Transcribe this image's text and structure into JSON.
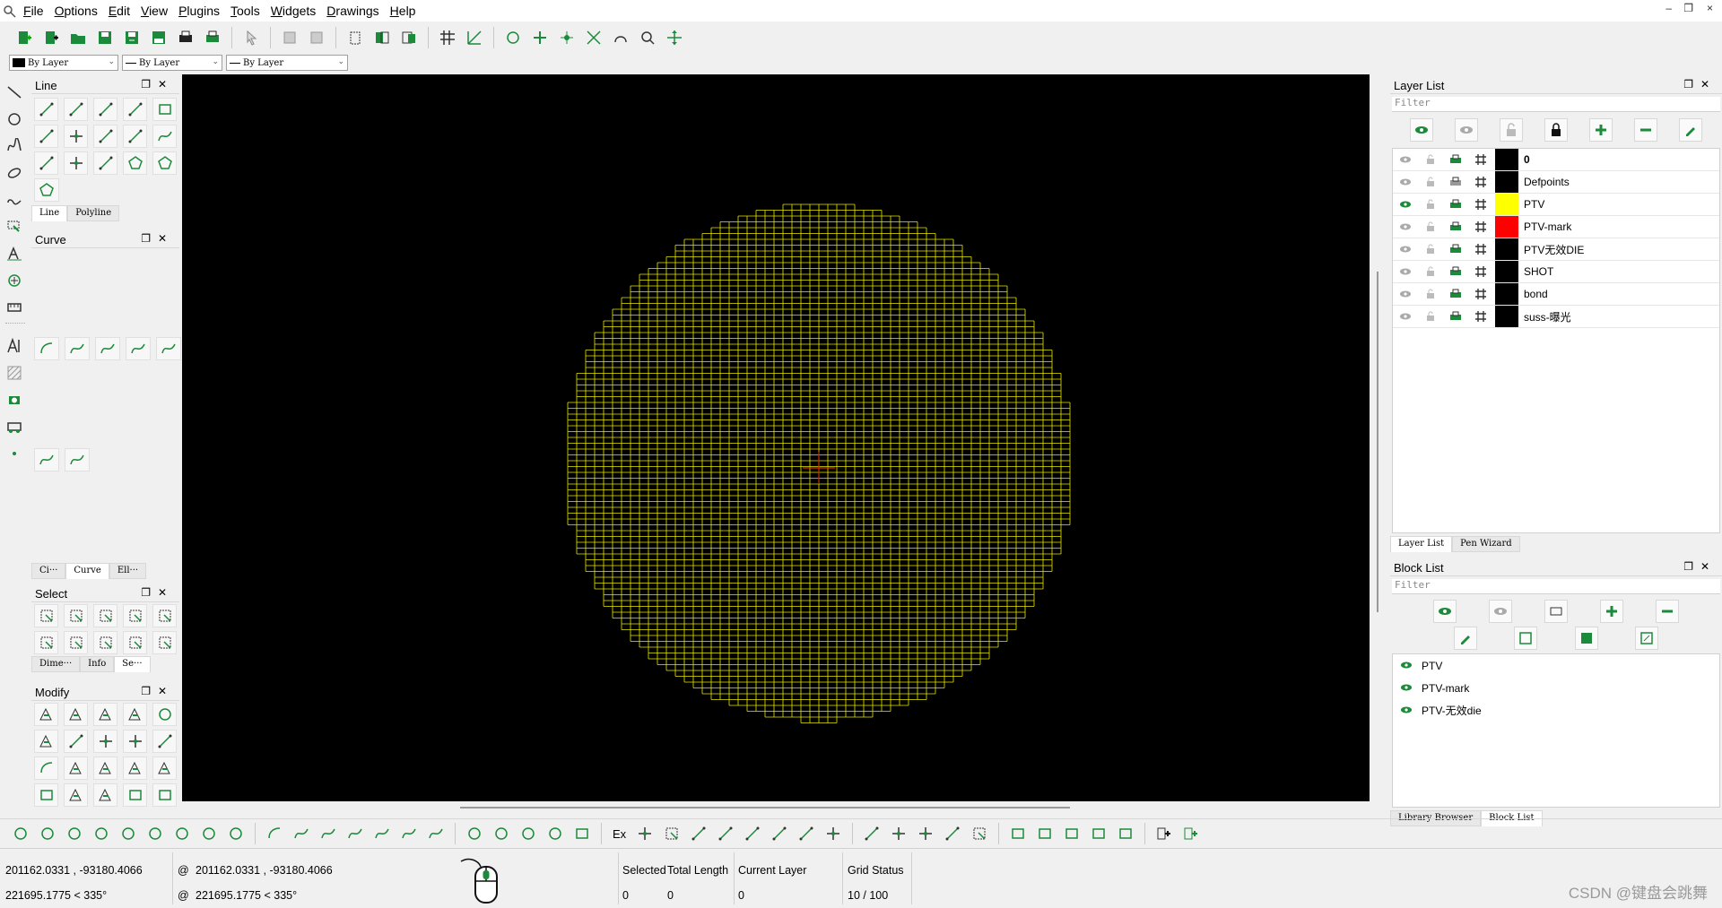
{
  "menubar": {
    "items": [
      "File",
      "Options",
      "Edit",
      "View",
      "Plugins",
      "Tools",
      "Widgets",
      "Drawings",
      "Help"
    ],
    "underline": [
      "F",
      "O",
      "E",
      "V",
      "P",
      "T",
      "W",
      "D",
      "H"
    ]
  },
  "window_controls": [
    "–",
    "❐",
    "×"
  ],
  "pen_toolbar": {
    "color": "By Layer",
    "width": "By Layer",
    "linetype": "By Layer"
  },
  "panels": {
    "line": {
      "title": "Line",
      "tabs": [
        "Line",
        "Polyline"
      ]
    },
    "curve": {
      "title": "Curve",
      "tabs": [
        "Ci···",
        "Curve",
        "Ell···"
      ]
    },
    "select": {
      "title": "Select",
      "tabs": [
        "Dime···",
        "Info",
        "Se···"
      ]
    },
    "modify": {
      "title": "Modify"
    }
  },
  "layer_panel": {
    "title": "Layer List",
    "filter_placeholder": "Filter",
    "layers": [
      {
        "name": "0",
        "color": "#000000",
        "visible": false,
        "bold": true
      },
      {
        "name": "Defpoints",
        "color": "#000000",
        "visible": false,
        "bold": false
      },
      {
        "name": "PTV",
        "color": "#ffff00",
        "visible": true,
        "bold": false
      },
      {
        "name": "PTV-mark",
        "color": "#ff0000",
        "visible": false,
        "bold": false
      },
      {
        "name": "PTV无效DIE",
        "color": "#000000",
        "visible": false,
        "bold": false
      },
      {
        "name": "SHOT",
        "color": "#000000",
        "visible": false,
        "bold": false
      },
      {
        "name": "bond",
        "color": "#000000",
        "visible": false,
        "bold": false
      },
      {
        "name": "suss-曝光",
        "color": "#000000",
        "visible": false,
        "bold": false
      }
    ],
    "tabs": [
      "Layer List",
      "Pen Wizard"
    ]
  },
  "block_panel": {
    "title": "Block List",
    "filter_placeholder": "Filter",
    "blocks": [
      "PTV",
      "PTV-mark",
      "PTV-无效die"
    ],
    "tabs": [
      "Library Browser",
      "Block List"
    ]
  },
  "status": {
    "abs_coords": "201162.0331 , -93180.4066",
    "abs_polar": "221695.1775 < 335°",
    "rel_coords": "201162.0331 , -93180.4066",
    "rel_polar": "221695.1775 < 335°",
    "at": "@",
    "selected_label": "Selected",
    "selected_value": "0",
    "total_length_label": "Total Length",
    "total_length_value": "0",
    "current_layer_label": "Current Layer",
    "current_layer_value": "0",
    "grid_status_label": "Grid Status",
    "grid_status_value": "10 / 100"
  },
  "snap_label": "Ex",
  "watermark": "CSDN @键盘会跳舞",
  "colors": {
    "canvas_bg": "#000000",
    "wafer_grid": "#e6e600",
    "accent_green": "#1b8a3a",
    "crosshair": "#c83200"
  }
}
